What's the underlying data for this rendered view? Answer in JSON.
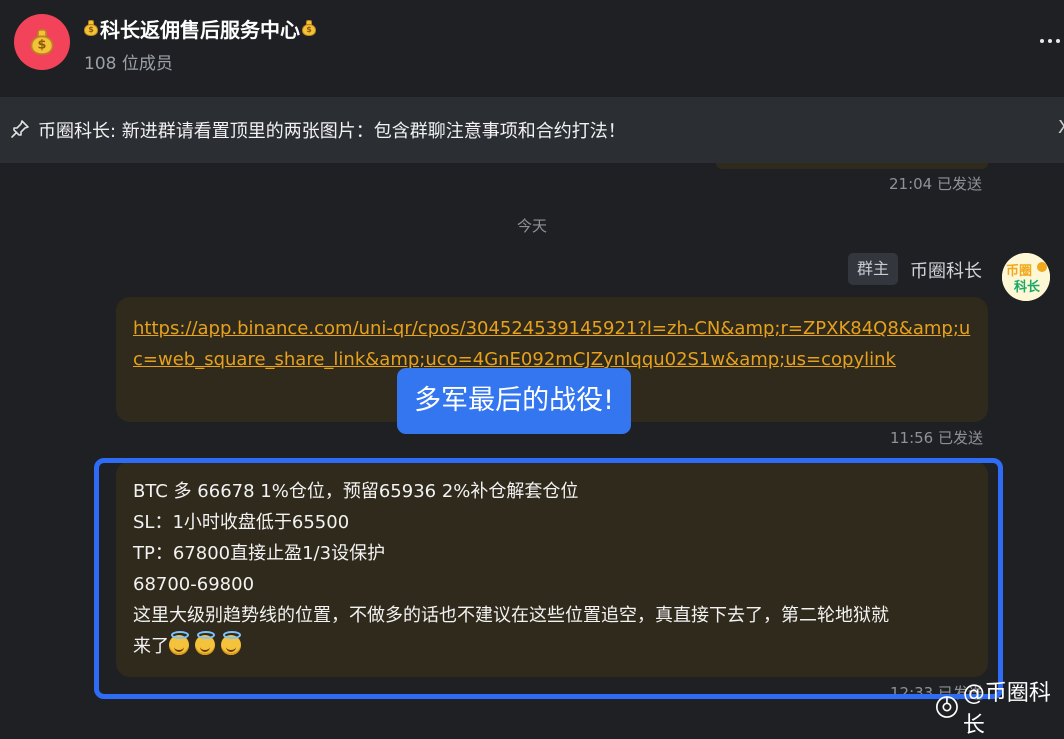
{
  "header": {
    "title": "科长返佣售后服务中心",
    "member_count": "108 位成员",
    "more_icon": "more-dots-icon",
    "title_icons": "moneybag-icon"
  },
  "pinned": {
    "text": "币圈科长: 新进群请看置顶里的两张图片：包含群聊注意事项和合约打法！",
    "close": "X",
    "icon": "pin-icon"
  },
  "chat": {
    "prev_time": "21:04 已发送",
    "date_separator": "今天",
    "sender": {
      "role": "群主",
      "name": "币圈科长",
      "avatar_text_top": "币圈",
      "avatar_text_bottom": "科长"
    },
    "link_message": {
      "url": "https://app.binance.com/uni-qr/cpos/304524539145921?l=zh-CN&amp;r=ZPXK84Q8&amp;uc=web_square_share_link&amp;uco=4GnE092mCJZynIqqu02S1w&amp;us=copylink",
      "time": "11:56 已发送"
    },
    "signal_message": {
      "lines": [
        "BTC 多  66678 1%仓位，预留65936  2%补仓解套仓位",
        "SL：1小时收盘低于65500",
        "TP：67800直接止盈1/3设保护",
        "68700-69800",
        "这里大级别趋势线的位置，不做多的话也不建议在这些位置追空，真直接下去了，第二轮地狱就",
        "来了"
      ],
      "emoji": "smiling-face-with-halo-icon",
      "time": "12:33 已发送"
    }
  },
  "overlay": {
    "callout": "多军最后的战役!",
    "watermark": "@币圈科长"
  },
  "colors": {
    "background": "#1e2024",
    "bubble": "#2f2a1c",
    "link": "#e6a11d",
    "highlight": "#2f6cf5",
    "callout": "#3476f0",
    "group_avatar": "#f2435a"
  }
}
